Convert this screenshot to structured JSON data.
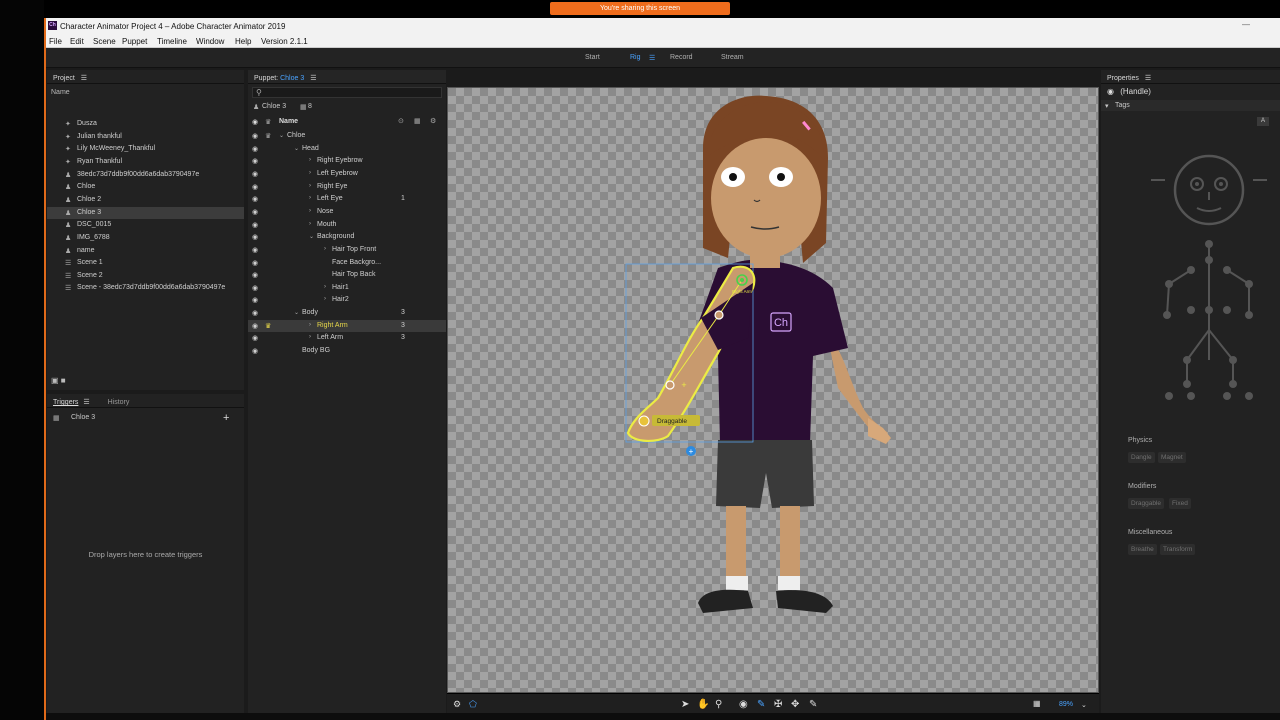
{
  "titlebar": {
    "title": "Character Animator Project 4 – Adobe Character Animator 2019",
    "app_icon": "Ch"
  },
  "share_banner": "You're sharing this screen",
  "menu": [
    "File",
    "Edit",
    "Scene",
    "Puppet",
    "Timeline",
    "Window",
    "Help",
    "Version 2.1.1"
  ],
  "modes": {
    "start": "Start",
    "rig": "Rig",
    "record": "Record",
    "stream": "Stream",
    "active": "Rig"
  },
  "project": {
    "title": "Project",
    "col_name": "Name",
    "items": [
      {
        "label": "Dusza",
        "icon": "puppet-icon"
      },
      {
        "label": "Julian thankful",
        "icon": "puppet-icon"
      },
      {
        "label": "Lily McWeeney_Thankful",
        "icon": "puppet-icon"
      },
      {
        "label": "Ryan Thankful",
        "icon": "puppet-icon"
      },
      {
        "label": "38edc73d7ddb9f00dd6a6dab3790497e",
        "icon": "figure-icon"
      },
      {
        "label": "Chloe",
        "icon": "figure-icon"
      },
      {
        "label": "Chloe 2",
        "icon": "figure-icon"
      },
      {
        "label": "Chloe 3",
        "icon": "figure-icon",
        "selected": true
      },
      {
        "label": "DSC_0015",
        "icon": "figure-icon"
      },
      {
        "label": "IMG_6788",
        "icon": "figure-icon"
      },
      {
        "label": "name",
        "icon": "figure-icon"
      },
      {
        "label": "Scene 1",
        "icon": "scene-icon"
      },
      {
        "label": "Scene 2",
        "icon": "scene-icon"
      },
      {
        "label": "Scene - 38edc73d7ddb9f00dd6a6dab3790497e",
        "icon": "scene-icon"
      }
    ]
  },
  "triggers": {
    "tab_triggers": "Triggers",
    "tab_history": "History",
    "puppet": "Chloe 3",
    "add": "+",
    "empty_hint": "Drop layers here to create triggers"
  },
  "puppet_panel": {
    "title": "Puppet:",
    "puppet_name": "Chloe 3",
    "crumb": "Chloe 3",
    "crumb_count": "8",
    "col_name": "Name",
    "layers": [
      {
        "label": "Chloe",
        "depth": 0,
        "arrow": "v",
        "count": ""
      },
      {
        "label": "Head",
        "depth": 1,
        "arrow": "v",
        "count": ""
      },
      {
        "label": "Right Eyebrow",
        "depth": 2,
        "arrow": ">",
        "count": ""
      },
      {
        "label": "Left Eyebrow",
        "depth": 2,
        "arrow": ">",
        "count": ""
      },
      {
        "label": "Right Eye",
        "depth": 2,
        "arrow": ">",
        "count": ""
      },
      {
        "label": "Left Eye",
        "depth": 2,
        "arrow": ">",
        "count": "1"
      },
      {
        "label": "Nose",
        "depth": 2,
        "arrow": ">",
        "count": ""
      },
      {
        "label": "Mouth",
        "depth": 2,
        "arrow": ">",
        "count": ""
      },
      {
        "label": "Background",
        "depth": 2,
        "arrow": "v",
        "count": ""
      },
      {
        "label": "Hair Top Front",
        "depth": 3,
        "arrow": ">",
        "count": ""
      },
      {
        "label": "Face Backgro...",
        "depth": 3,
        "arrow": "",
        "count": ""
      },
      {
        "label": "Hair Top Back",
        "depth": 3,
        "arrow": "",
        "count": ""
      },
      {
        "label": "Hair1",
        "depth": 3,
        "arrow": ">",
        "count": ""
      },
      {
        "label": "Hair2",
        "depth": 3,
        "arrow": ">",
        "count": ""
      },
      {
        "label": "Body",
        "depth": 1,
        "arrow": "v",
        "count": "3"
      },
      {
        "label": "Right Arm",
        "depth": 2,
        "arrow": ">",
        "count": "3",
        "selected": true
      },
      {
        "label": "Left Arm",
        "depth": 2,
        "arrow": ">",
        "count": "3"
      },
      {
        "label": "Body BG",
        "depth": 1,
        "arrow": "",
        "count": ""
      }
    ]
  },
  "scene": {
    "handle_label": "Right Arm",
    "draggable_label": "Draggable",
    "shirt_logo": "Ch",
    "zoom": "89%"
  },
  "properties": {
    "title": "Properties",
    "handle": "(Handle)",
    "tags_label": "Tags",
    "tag_badge": "A",
    "sections": [
      {
        "name": "Physics",
        "tags": [
          "Dangle",
          "Magnet"
        ]
      },
      {
        "name": "Modifiers",
        "tags": [
          "Draggable",
          "Fixed"
        ]
      },
      {
        "name": "Miscellaneous",
        "tags": [
          "Breathe",
          "Transform"
        ]
      }
    ]
  },
  "colors": {
    "accent": "#4aa3ff",
    "share": "#ef6c1c",
    "handle_yellow": "#e8e84a",
    "shirt": "#2a0d33"
  }
}
